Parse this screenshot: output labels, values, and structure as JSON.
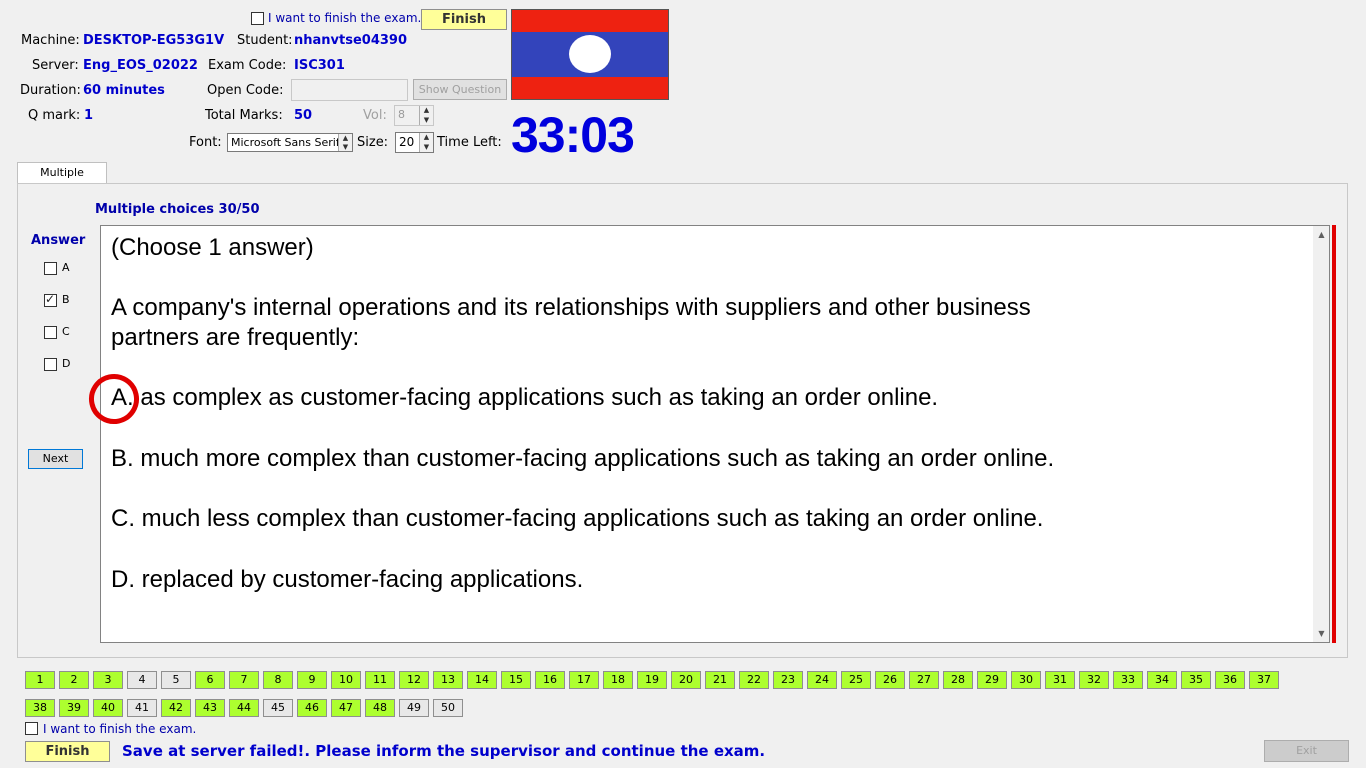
{
  "header": {
    "finish_check_label": "I want to finish the exam.",
    "finish_button": "Finish",
    "machine_label": "Machine:",
    "machine_value": "DESKTOP-EG53G1V",
    "student_label": "Student:",
    "student_value": "nhanvtse04390",
    "server_label": "Server:",
    "server_value": "Eng_EOS_02022",
    "exam_code_label": "Exam Code:",
    "exam_code_value": "ISC301",
    "duration_label": "Duration:",
    "duration_value": "60 minutes",
    "open_code_label": "Open Code:",
    "open_code_value": "",
    "show_question_button": "Show Question",
    "qmark_label": "Q mark:",
    "qmark_value": "1",
    "total_marks_label": "Total Marks:",
    "total_marks_value": "50",
    "vol_label": "Vol:",
    "vol_value": "8",
    "font_label": "Font:",
    "font_value": "Microsoft Sans Serif",
    "size_label": "Size:",
    "size_value": "20",
    "time_left_label": "Time Left:",
    "time_left_value": "33:03"
  },
  "tab": {
    "label": "Multiple Choices"
  },
  "question": {
    "progress": "Multiple choices 30/50",
    "answer_label": "Answer",
    "options": [
      {
        "letter": "A",
        "checked": false
      },
      {
        "letter": "B",
        "checked": true
      },
      {
        "letter": "C",
        "checked": false
      },
      {
        "letter": "D",
        "checked": false
      }
    ],
    "next_button": "Next",
    "lines": {
      "instruction": "(Choose 1 answer)",
      "stem_1": "A company's internal operations and its relationships with suppliers and other business",
      "stem_2": "partners are frequently:",
      "choice_a": "A.  as complex as customer-facing applications such as taking an order online.",
      "choice_b": "B.  much more complex than customer-facing applications such as taking an order online.",
      "choice_c": "C.  much less complex than customer-facing applications such as taking an order online.",
      "choice_d": "D.  replaced by customer-facing applications."
    }
  },
  "question_grid": {
    "row1": [
      {
        "n": "1",
        "done": true
      },
      {
        "n": "2",
        "done": true
      },
      {
        "n": "3",
        "done": true
      },
      {
        "n": "4",
        "done": false
      },
      {
        "n": "5",
        "done": false
      },
      {
        "n": "6",
        "done": true
      },
      {
        "n": "7",
        "done": true
      },
      {
        "n": "8",
        "done": true
      },
      {
        "n": "9",
        "done": true
      },
      {
        "n": "10",
        "done": true
      },
      {
        "n": "11",
        "done": true
      },
      {
        "n": "12",
        "done": true
      },
      {
        "n": "13",
        "done": true
      },
      {
        "n": "14",
        "done": true
      },
      {
        "n": "15",
        "done": true
      },
      {
        "n": "16",
        "done": true
      },
      {
        "n": "17",
        "done": true
      },
      {
        "n": "18",
        "done": true
      },
      {
        "n": "19",
        "done": true
      },
      {
        "n": "20",
        "done": true
      },
      {
        "n": "21",
        "done": true
      },
      {
        "n": "22",
        "done": true
      },
      {
        "n": "23",
        "done": true
      },
      {
        "n": "24",
        "done": true
      },
      {
        "n": "25",
        "done": true
      },
      {
        "n": "26",
        "done": true
      },
      {
        "n": "27",
        "done": true
      },
      {
        "n": "28",
        "done": true
      },
      {
        "n": "29",
        "done": true
      },
      {
        "n": "30",
        "done": true
      },
      {
        "n": "31",
        "done": true
      },
      {
        "n": "32",
        "done": true
      },
      {
        "n": "33",
        "done": true
      },
      {
        "n": "34",
        "done": true
      },
      {
        "n": "35",
        "done": true
      },
      {
        "n": "36",
        "done": true
      },
      {
        "n": "37",
        "done": true
      }
    ],
    "row2": [
      {
        "n": "38",
        "done": true
      },
      {
        "n": "39",
        "done": true
      },
      {
        "n": "40",
        "done": true
      },
      {
        "n": "41",
        "done": false
      },
      {
        "n": "42",
        "done": true
      },
      {
        "n": "43",
        "done": true
      },
      {
        "n": "44",
        "done": true
      },
      {
        "n": "45",
        "done": false
      },
      {
        "n": "46",
        "done": true
      },
      {
        "n": "47",
        "done": true
      },
      {
        "n": "48",
        "done": true
      },
      {
        "n": "49",
        "done": false
      },
      {
        "n": "50",
        "done": false
      }
    ]
  },
  "footer": {
    "finish_check_label": "I want to finish the exam.",
    "finish_button": "Finish",
    "status_message": "Save at server failed!. Please inform the supervisor and continue the exam.",
    "exit_button": "Exit"
  },
  "colors": {
    "accent_blue": "#0000cc",
    "finish_yellow": "#ffff99",
    "answered_green": "#adff2f",
    "flag_red": "#ee2211",
    "flag_blue": "#3344bb",
    "scroll_red": "#e00000"
  }
}
